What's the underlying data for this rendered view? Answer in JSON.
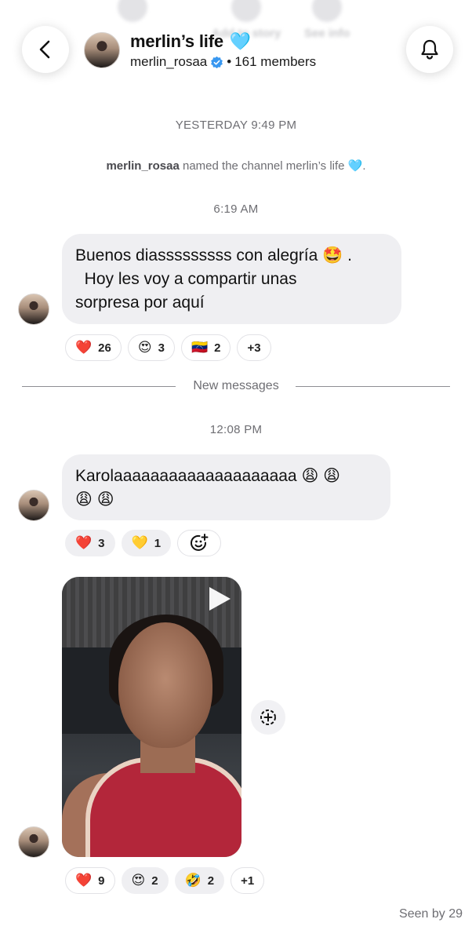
{
  "header": {
    "ghost_labels": [
      "",
      "Add to story",
      "See info"
    ],
    "title": "merlin’s life",
    "title_emoji": "🩵",
    "username": "merlin_rosaa",
    "members": "161 members",
    "separator": "•"
  },
  "system": {
    "timestamp_1": "YESTERDAY 9:49 PM",
    "rename_user": "merlin_rosaa",
    "rename_text": "named the channel merlin’s life",
    "rename_emoji": "🩵",
    "rename_end": "."
  },
  "messages": [
    {
      "timestamp": "6:19 AM",
      "lines": [
        "Buenos diasssssssss con alegría 🤩 .",
        "  Hoy les voy a compartir unas",
        "sorpresa por aquí"
      ],
      "reactions": [
        {
          "emoji": "❤️",
          "count": "26"
        },
        {
          "emoji": "😍",
          "count": "3"
        },
        {
          "emoji": "🇻🇪",
          "count": "2"
        },
        {
          "emoji": "",
          "count": "+3"
        }
      ]
    },
    {
      "timestamp": "12:08 PM",
      "lines": [
        "Karolaaaaaaaaaaaaaaaaaaaa 😩 😩",
        "😩 😩"
      ],
      "reactions": [
        {
          "emoji": "❤️",
          "count": "3"
        },
        {
          "emoji": "💛",
          "count": "1"
        }
      ]
    },
    {
      "reactions": [
        {
          "emoji": "❤️",
          "count": "9"
        },
        {
          "emoji": "😍",
          "count": "2"
        },
        {
          "emoji": "🤣",
          "count": "2"
        },
        {
          "emoji": "",
          "count": "+1"
        }
      ]
    }
  ],
  "divider_label": "New messages",
  "seen": "Seen by 29"
}
